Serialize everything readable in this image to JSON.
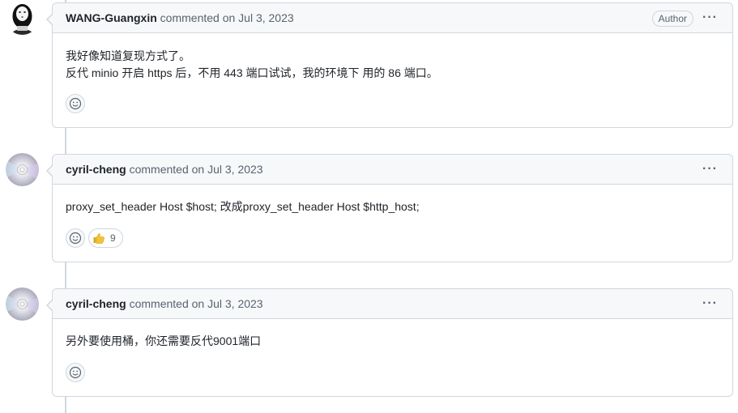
{
  "comments": [
    {
      "author": "WANG-Guangxin",
      "meta": "commented on Jul 3, 2023",
      "badge": "Author",
      "body_lines": [
        "我好像知道复现方式了。",
        "反代 minio 开启 https 后，不用 443 端口试试，我的环境下 用的 86 端口。"
      ],
      "avatar_icon": "no-face-avatar-icon"
    },
    {
      "author": "cyril-cheng",
      "meta": "commented on Jul 3, 2023",
      "body_lines": [
        "proxy_set_header Host $host; 改成proxy_set_header Host $http_host;"
      ],
      "reaction": {
        "emoji": "thumbs-up-icon",
        "count": "9"
      },
      "avatar_icon": "disc-avatar-icon"
    },
    {
      "author": "cyril-cheng",
      "meta": "commented on Jul 3, 2023",
      "body_lines": [
        "另外要使用桶，你还需要反代9001端口"
      ],
      "avatar_icon": "disc-avatar-icon"
    }
  ],
  "ui": {
    "more_menu": "···"
  },
  "colors": {
    "border": "#d0d7de",
    "header_bg": "#f6f8fa",
    "muted": "#59636e"
  }
}
